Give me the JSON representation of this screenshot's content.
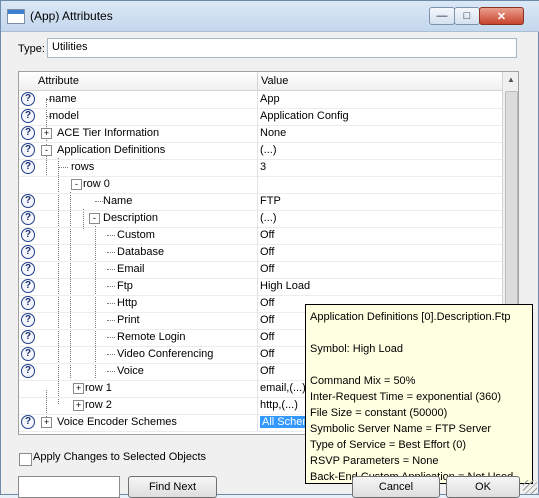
{
  "window": {
    "title": "(App) Attributes",
    "controls": {
      "minimize": "—",
      "maximize": "□",
      "close": "✕"
    }
  },
  "type_field": {
    "label": "Type:",
    "value": "Utilities"
  },
  "grid": {
    "headers": {
      "attribute": "Attribute",
      "value": "Value"
    },
    "rows": [
      {
        "attr": "name",
        "value": "App"
      },
      {
        "attr": "model",
        "value": "Application Config"
      },
      {
        "attr": "ACE Tier Information",
        "value": "None"
      },
      {
        "attr": "Application Definitions",
        "value": "(...)"
      },
      {
        "attr": "rows",
        "value": "3"
      },
      {
        "attr": "row 0",
        "value": ""
      },
      {
        "attr": "Name",
        "value": "FTP"
      },
      {
        "attr": "Description",
        "value": "(...)"
      },
      {
        "attr": "Custom",
        "value": "Off"
      },
      {
        "attr": "Database",
        "value": "Off"
      },
      {
        "attr": "Email",
        "value": "Off"
      },
      {
        "attr": "Ftp",
        "value": "High Load"
      },
      {
        "attr": "Http",
        "value": "Off"
      },
      {
        "attr": "Print",
        "value": "Off"
      },
      {
        "attr": "Remote Login",
        "value": "Off"
      },
      {
        "attr": "Video Conferencing",
        "value": "Off"
      },
      {
        "attr": "Voice",
        "value": "Off"
      },
      {
        "attr": "row 1",
        "value": "email,(...)"
      },
      {
        "attr": "row 2",
        "value": "http,(...)"
      },
      {
        "attr": "Voice Encoder Schemes",
        "value": "All Schem"
      }
    ]
  },
  "tooltip": {
    "line1": "Application Definitions [0].Description.Ftp",
    "line2": "Symbol: High Load",
    "line3": "Command Mix = 50%",
    "line4": "Inter-Request Time = exponential (360)",
    "line5": "File Size = constant (50000)",
    "line6": "Symbolic Server Name = FTP Server",
    "line7": "Type of Service = Best Effort (0)",
    "line8": "RSVP Parameters = None",
    "line9": "Back-End Custom Application = Not Used"
  },
  "footer": {
    "apply_label": "Apply Changes to Selected Objects",
    "find_next": "Find Next",
    "cancel": "Cancel",
    "ok": "OK"
  },
  "icons": {
    "help": "question-icon",
    "expand": "plus-icon",
    "collapse": "minus-icon"
  }
}
